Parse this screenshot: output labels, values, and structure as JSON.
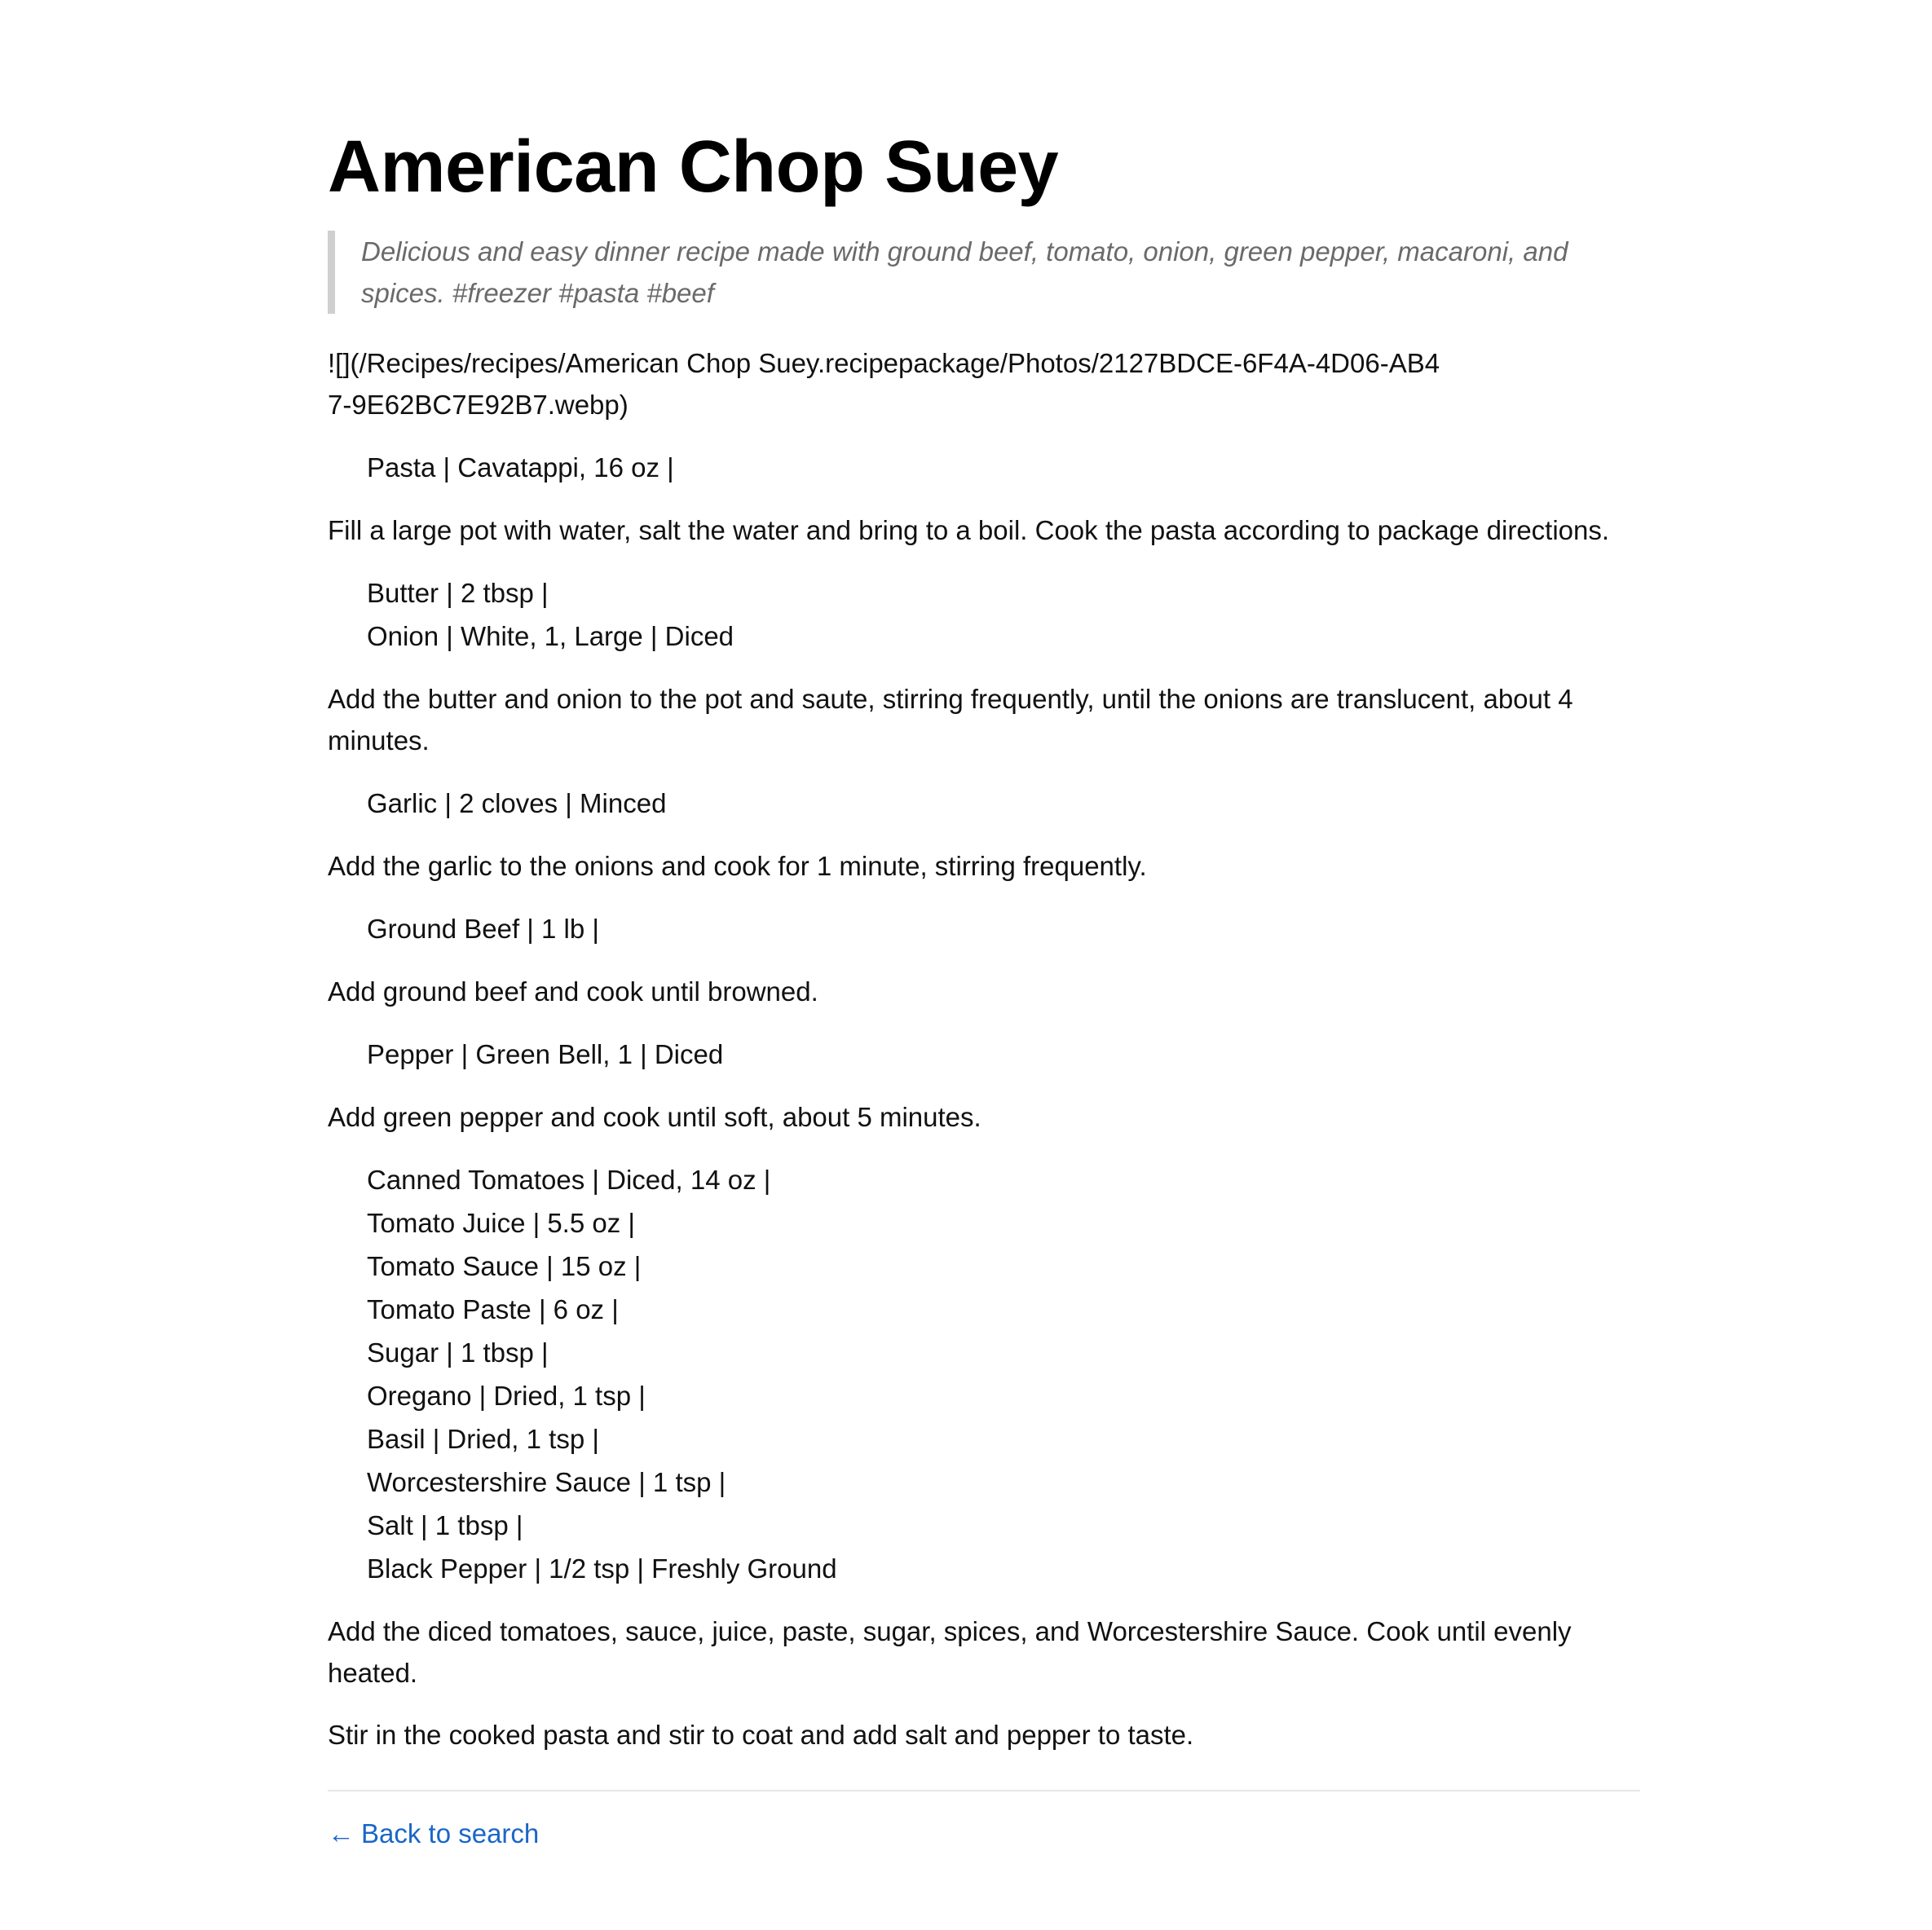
{
  "recipe": {
    "title": "American Chop Suey",
    "summary": "Delicious and easy dinner recipe made with ground beef, tomato, onion, green pepper, macaroni, and spices. #freezer #pasta #beef",
    "image_ref": "![](/Recipes/recipes/American Chop Suey.recipepackage/Photos/2127BDCE-6F4A-4D06-AB47-9E62BC7E92B7.webp)",
    "steps": [
      {
        "ingredients": [
          "Pasta | Cavatappi, 16 oz |"
        ],
        "instruction": "Fill a large pot with water, salt the water and bring to a boil. Cook the pasta according to package directions."
      },
      {
        "ingredients": [
          "Butter | 2 tbsp |",
          "Onion | White, 1, Large | Diced"
        ],
        "instruction": "Add the butter and onion to the pot and saute, stirring frequently, until the onions are translucent, about 4 minutes."
      },
      {
        "ingredients": [
          "Garlic | 2 cloves | Minced"
        ],
        "instruction": "Add the garlic to the onions and cook for 1 minute, stirring frequently."
      },
      {
        "ingredients": [
          "Ground Beef | 1 lb |"
        ],
        "instruction": "Add ground beef and cook until browned."
      },
      {
        "ingredients": [
          "Pepper | Green Bell, 1 | Diced"
        ],
        "instruction": "Add green pepper and cook until soft, about 5 minutes."
      },
      {
        "ingredients": [
          "Canned Tomatoes | Diced, 14 oz |",
          "Tomato Juice | 5.5 oz |",
          "Tomato Sauce | 15 oz |",
          "Tomato Paste | 6 oz |",
          "Sugar | 1 tbsp |",
          "Oregano | Dried, 1 tsp |",
          "Basil | Dried, 1 tsp |",
          "Worcestershire Sauce | 1 tsp |",
          "Salt | 1 tbsp |",
          "Black Pepper | 1/2 tsp | Freshly Ground"
        ],
        "instruction": "Add the diced tomatoes, sauce, juice, paste, sugar, spices, and Worcestershire Sauce. Cook until evenly heated."
      }
    ],
    "final_instruction": "Stir in the cooked pasta and stir to coat and add salt and pepper to taste."
  },
  "footer": {
    "back_arrow": "←",
    "back_label": "Back to search"
  },
  "colors": {
    "link": "#1a66c8",
    "quote_border": "#cfcfcf",
    "quote_text": "#6a6a6a"
  }
}
